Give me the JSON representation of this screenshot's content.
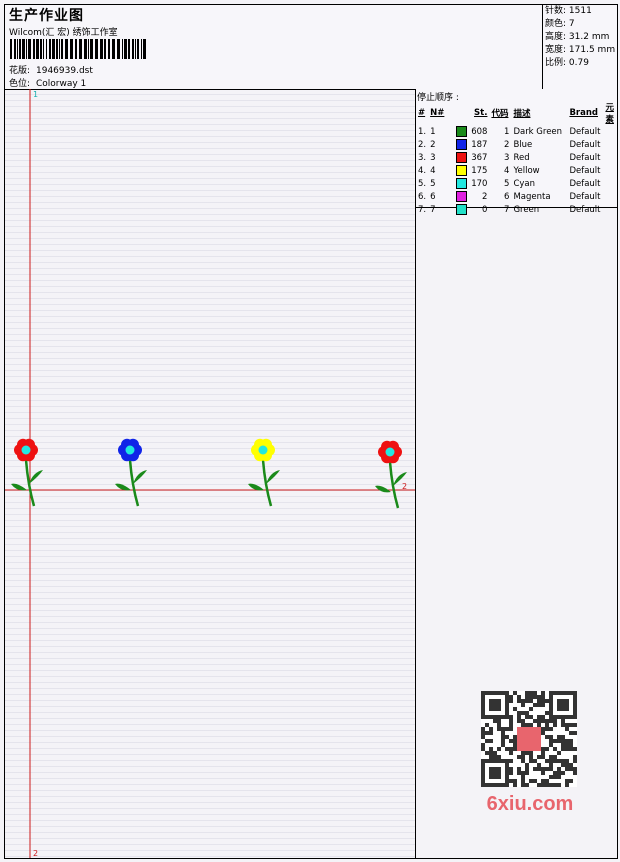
{
  "header": {
    "title": "生产作业图",
    "company": "Wilcom(汇 宏) 绣饰工作室",
    "design_label": "花版:",
    "design_value": "1946939.dst",
    "colorway_label": "色位:",
    "colorway_value": "Colorway 1"
  },
  "stats": [
    {
      "label": "针数",
      "value": "1511"
    },
    {
      "label": "颜色",
      "value": "7"
    },
    {
      "label": "高度",
      "value": "31.2 mm"
    },
    {
      "label": "宽度",
      "value": "171.5 mm"
    },
    {
      "label": "比例",
      "value": "0.79"
    }
  ],
  "sequence": {
    "title": "停止顺序 :",
    "headers": [
      "#",
      "N#",
      "St.",
      "代码",
      "描述",
      "Brand",
      "元素"
    ],
    "rows": [
      {
        "idx": "1.",
        "n": "1",
        "color": "#1a8a1a",
        "st": "608",
        "code": "1",
        "desc": "Dark Green",
        "brand": "Default"
      },
      {
        "idx": "2.",
        "n": "2",
        "color": "#1024e8",
        "st": "187",
        "code": "2",
        "desc": "Blue",
        "brand": "Default"
      },
      {
        "idx": "3.",
        "n": "3",
        "color": "#ee1111",
        "st": "367",
        "code": "3",
        "desc": "Red",
        "brand": "Default"
      },
      {
        "idx": "4.",
        "n": "4",
        "color": "#ffff00",
        "st": "175",
        "code": "4",
        "desc": "Yellow",
        "brand": "Default"
      },
      {
        "idx": "5.",
        "n": "5",
        "color": "#22e8e0",
        "st": "170",
        "code": "5",
        "desc": "Cyan",
        "brand": "Default"
      },
      {
        "idx": "6.",
        "n": "6",
        "color": "#e020e0",
        "st": "2",
        "code": "6",
        "desc": "Magenta",
        "brand": "Default"
      },
      {
        "idx": "7.",
        "n": "7",
        "color": "#22e0c8",
        "st": "0",
        "code": "7",
        "desc": "Green",
        "brand": "Default"
      }
    ]
  },
  "markers": {
    "top": "1",
    "right": "2",
    "bottom": "2"
  },
  "design": {
    "flowers": [
      {
        "petal": "#ee1111",
        "center": "#22e8e0"
      },
      {
        "petal": "#1024e8",
        "center": "#22e8e0"
      },
      {
        "petal": "#ffff00",
        "center": "#22e8e0"
      },
      {
        "petal": "#ee1111",
        "center": "#22e8e0"
      }
    ],
    "stem_color": "#1a8a1a",
    "guide_color": "#cc1a1a"
  },
  "watermark": {
    "text": "6xiu.com"
  }
}
